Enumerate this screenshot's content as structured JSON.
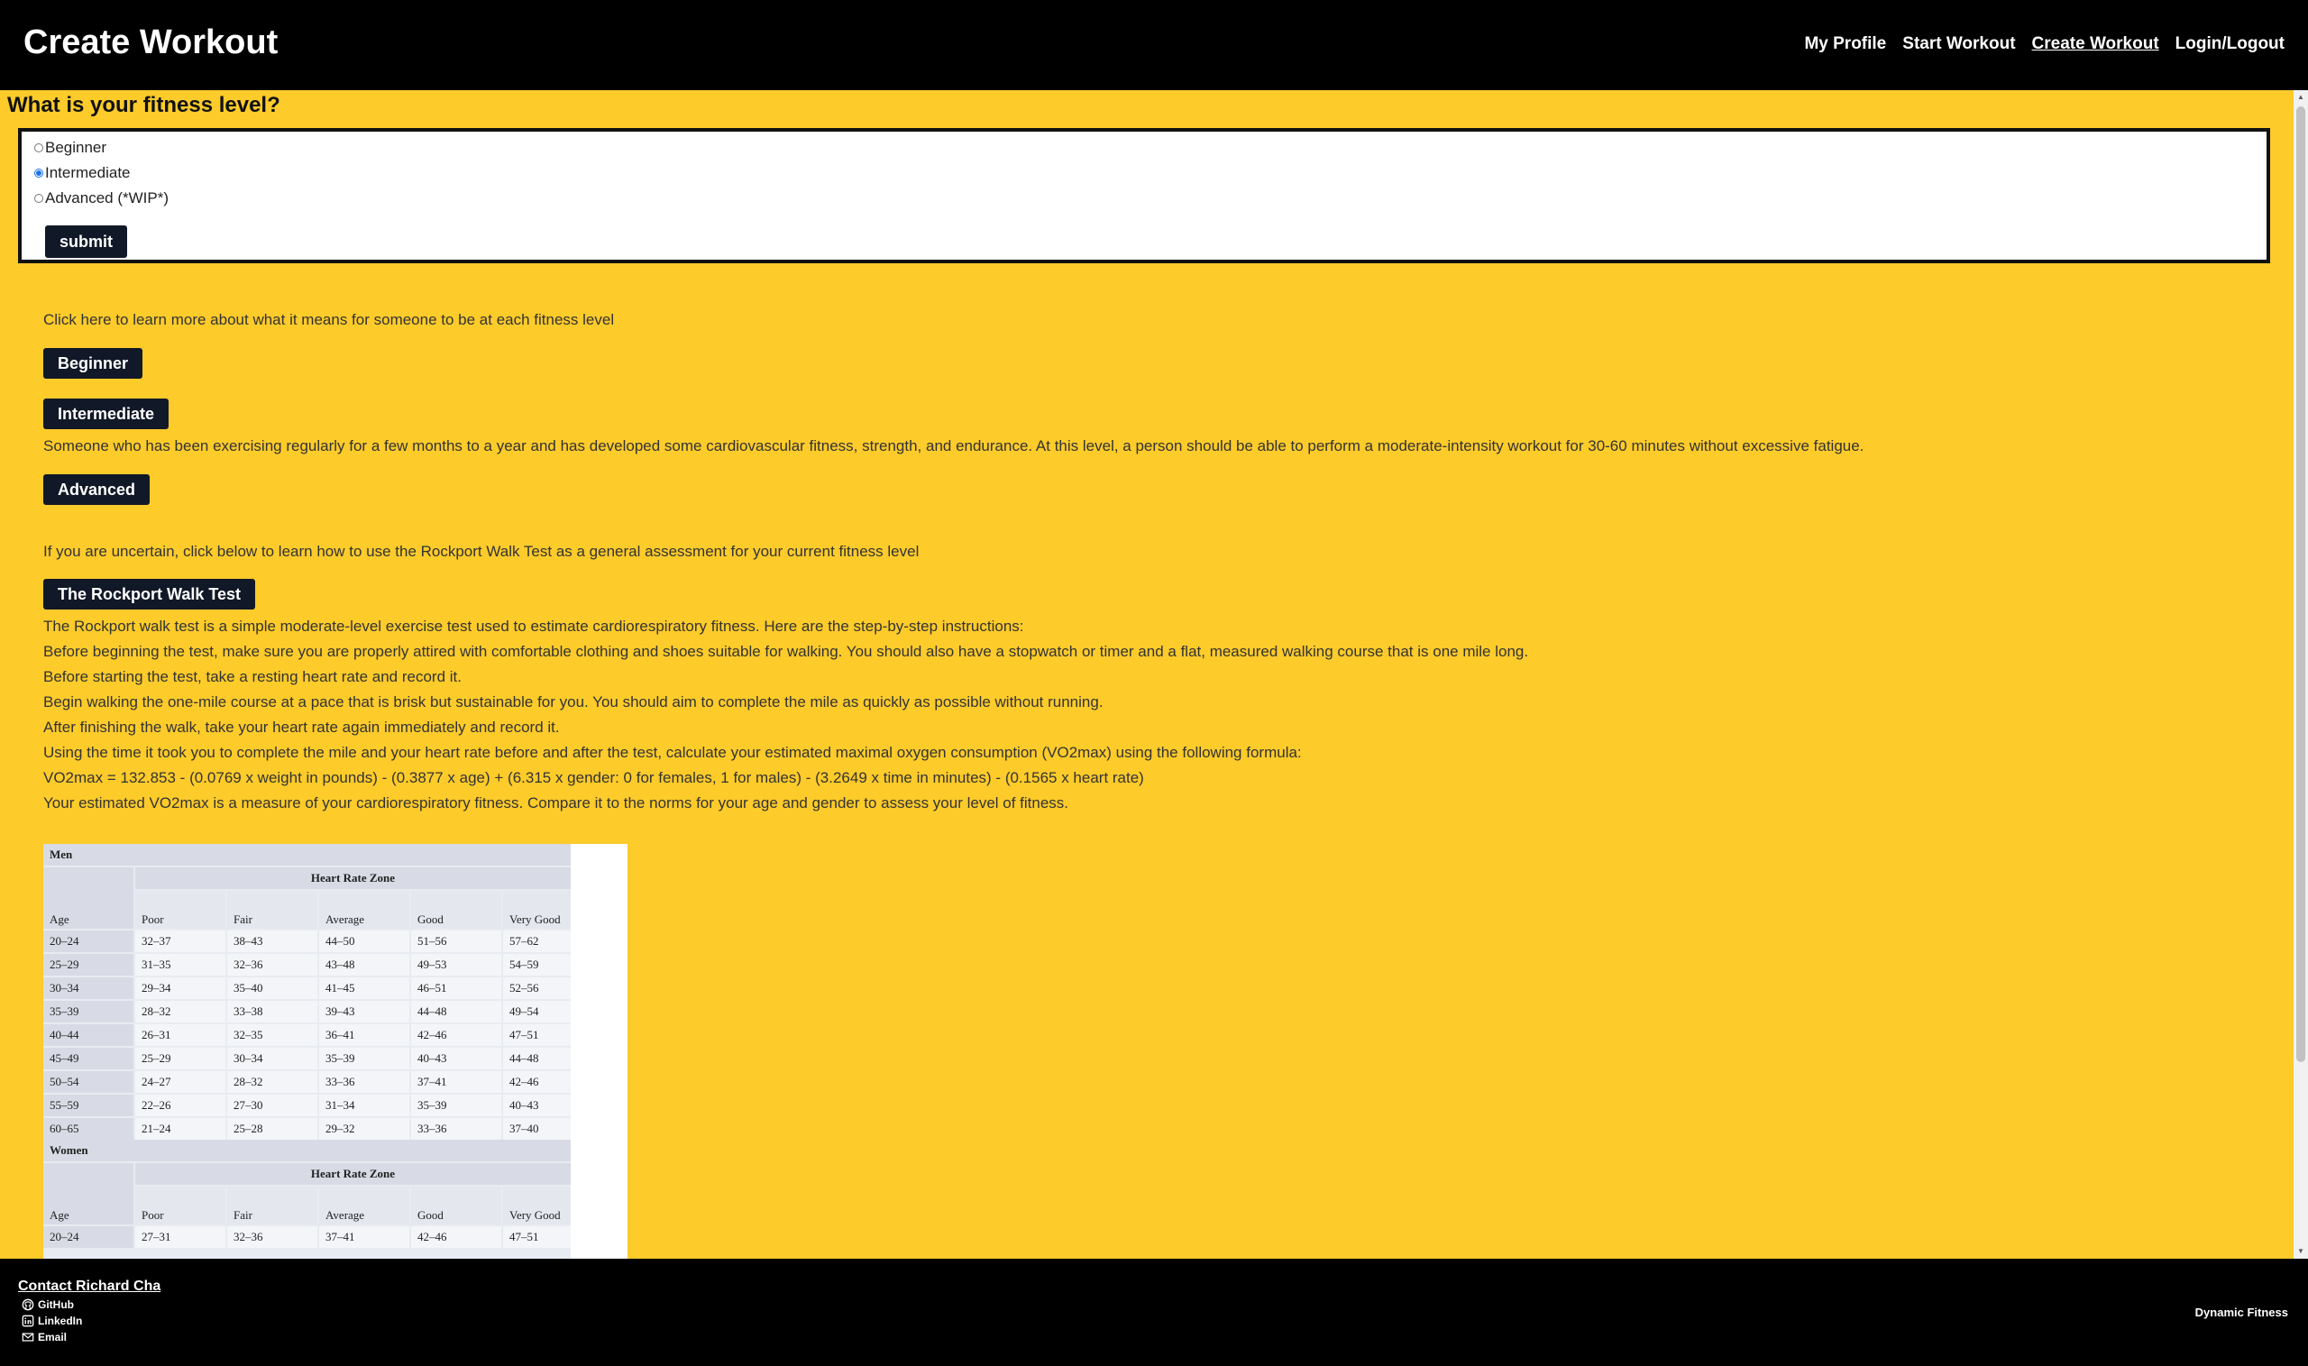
{
  "header": {
    "title": "Create Workout",
    "nav": [
      "My Profile",
      "Start Workout",
      "Create Workout",
      "Login/Logout"
    ],
    "active_nav": "Create Workout"
  },
  "fitness_form": {
    "question": "What is your fitness level?",
    "options": [
      "Beginner",
      "Intermediate",
      "Advanced (*WIP*)"
    ],
    "selected": "Intermediate",
    "submit_label": "submit"
  },
  "learn_more": {
    "intro": "Click here to learn more about what it means for someone to be at each fitness level",
    "beginner_button": "Beginner",
    "intermediate_button": "Intermediate",
    "intermediate_description": "Someone who has been exercising regularly for a few months to a year and has developed some cardiovascular fitness, strength, and endurance. At this level, a person should be able to perform a moderate-intensity workout for 30-60 minutes without excessive fatigue.",
    "advanced_button": "Advanced"
  },
  "rockport": {
    "intro": "If you are uncertain, click below to learn how to use the Rockport Walk Test as a general assessment for your current fitness level",
    "button": "The Rockport Walk Test",
    "lines": [
      "The Rockport walk test is a simple moderate-level exercise test used to estimate cardiorespiratory fitness. Here are the step-by-step instructions:",
      "Before beginning the test, make sure you are properly attired with comfortable clothing and shoes suitable for walking. You should also have a stopwatch or timer and a flat, measured walking course that is one mile long.",
      "Before starting the test, take a resting heart rate and record it.",
      "Begin walking the one-mile course at a pace that is brisk but sustainable for you. You should aim to complete the mile as quickly as possible without running.",
      "After finishing the walk, take your heart rate again immediately and record it.",
      "Using the time it took you to complete the mile and your heart rate before and after the test, calculate your estimated maximal oxygen consumption (VO2max) using the following formula:",
      "VO2max = 132.853 - (0.0769 x weight in pounds) - (0.3877 x age) + (6.315 x gender: 0 for females, 1 for males) - (3.2649 x time in minutes) - (0.1565 x heart rate)",
      "Your estimated VO2max is a measure of your cardiorespiratory fitness. Compare it to the norms for your age and gender to assess your level of fitness."
    ]
  },
  "norms_table": {
    "zone_header": "Heart Rate Zone",
    "age_header": "Age",
    "columns": [
      "Poor",
      "Fair",
      "Average",
      "Good",
      "Very Good"
    ],
    "men": {
      "label": "Men",
      "rows": [
        [
          "20–24",
          "32–37",
          "38–43",
          "44–50",
          "51–56",
          "57–62"
        ],
        [
          "25–29",
          "31–35",
          "32–36",
          "43–48",
          "49–53",
          "54–59"
        ],
        [
          "30–34",
          "29–34",
          "35–40",
          "41–45",
          "46–51",
          "52–56"
        ],
        [
          "35–39",
          "28–32",
          "33–38",
          "39–43",
          "44–48",
          "49–54"
        ],
        [
          "40–44",
          "26–31",
          "32–35",
          "36–41",
          "42–46",
          "47–51"
        ],
        [
          "45–49",
          "25–29",
          "30–34",
          "35–39",
          "40–43",
          "44–48"
        ],
        [
          "50–54",
          "24–27",
          "28–32",
          "33–36",
          "37–41",
          "42–46"
        ],
        [
          "55–59",
          "22–26",
          "27–30",
          "31–34",
          "35–39",
          "40–43"
        ],
        [
          "60–65",
          "21–24",
          "25–28",
          "29–32",
          "33–36",
          "37–40"
        ]
      ]
    },
    "women": {
      "label": "Women",
      "rows": [
        [
          "20–24",
          "27–31",
          "32–36",
          "37–41",
          "42–46",
          "47–51"
        ]
      ]
    }
  },
  "footer": {
    "contact_title": "Contact Richard Cha",
    "links": [
      {
        "label": "GitHub",
        "icon": "github-icon"
      },
      {
        "label": "LinkedIn",
        "icon": "linkedin-icon"
      },
      {
        "label": "Email",
        "icon": "email-icon"
      }
    ],
    "brand": "Dynamic Fitness"
  }
}
